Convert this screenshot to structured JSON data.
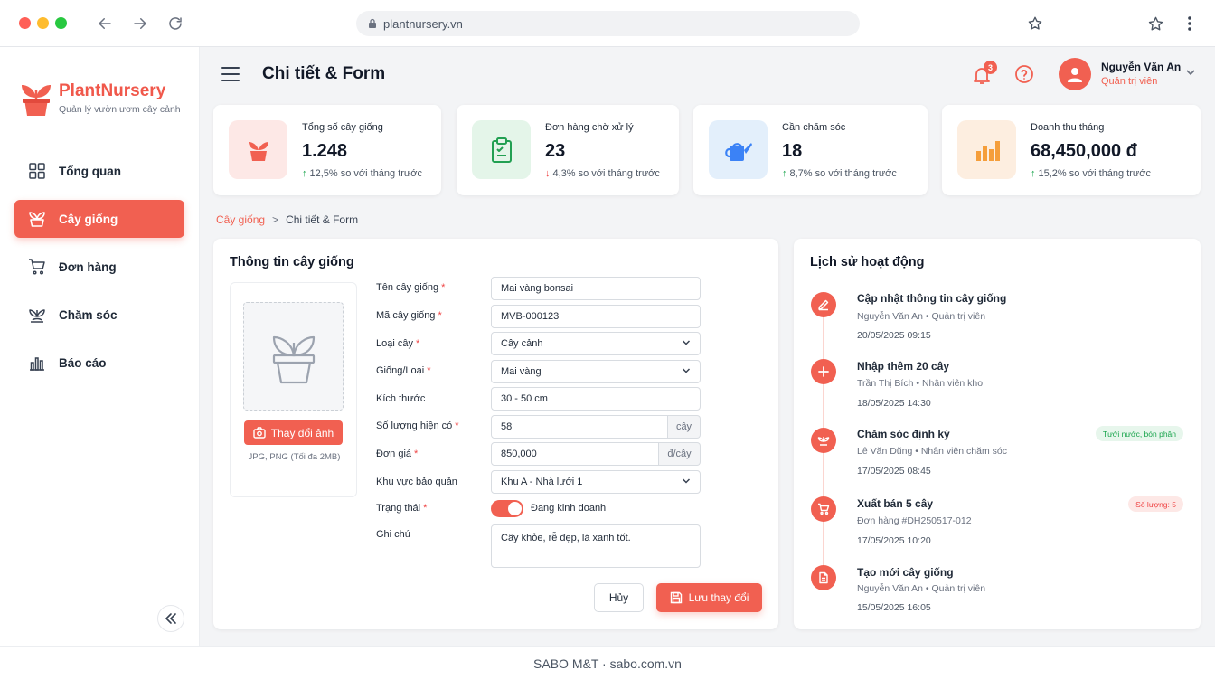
{
  "browser": {
    "url": "plantnursery.vn"
  },
  "brand": {
    "name": "PlantNursery",
    "tagline": "Quản lý vườn ươm cây cảnh",
    "accent": "#f16051"
  },
  "sidebar": {
    "items": [
      {
        "label": "Tổng quan",
        "icon": "grid-icon",
        "active": false
      },
      {
        "label": "Cây giống",
        "icon": "plant-icon",
        "active": true
      },
      {
        "label": "Đơn hàng",
        "icon": "cart-icon",
        "active": false
      },
      {
        "label": "Chăm sóc",
        "icon": "leaf-care-icon",
        "active": false
      },
      {
        "label": "Báo cáo",
        "icon": "bar-chart-icon",
        "active": false
      }
    ]
  },
  "header": {
    "title": "Chi tiết & Form",
    "notification_count": "3",
    "user": {
      "name": "Nguyễn Văn An",
      "role": "Quản trị viên"
    }
  },
  "stats": [
    {
      "label": "Tổng số cây giống",
      "value": "1.248",
      "trend": "12,5% so với tháng trước",
      "direction": "up",
      "icon": "plant-pot-icon"
    },
    {
      "label": "Đơn hàng chờ xử lý",
      "value": "23",
      "trend": "4,3% so với tháng trước",
      "direction": "down",
      "icon": "clipboard-icon"
    },
    {
      "label": "Cần chăm sóc",
      "value": "18",
      "trend": "8,7% so với tháng trước",
      "direction": "up",
      "icon": "watering-can-icon"
    },
    {
      "label": "Doanh thu tháng",
      "value": "68,450,000 đ",
      "trend": "15,2% so với tháng trước",
      "direction": "up",
      "icon": "bar-chart-icon"
    }
  ],
  "breadcrumb": {
    "parent": "Cây giống",
    "current": "Chi tiết & Form"
  },
  "form": {
    "title": "Thông tin cây giống",
    "upload_label": "Thay đổi ảnh",
    "upload_note": "JPG, PNG (Tối đa 2MB)",
    "fields": [
      {
        "label": "Tên cây giống",
        "required": true,
        "value": "Mai vàng bonsai",
        "kind": "text"
      },
      {
        "label": "Mã cây giống",
        "required": true,
        "value": "MVB-000123",
        "kind": "text"
      },
      {
        "label": "Loại cây",
        "required": true,
        "value": "Cây cảnh",
        "kind": "select"
      },
      {
        "label": "Giống/Loại",
        "required": true,
        "value": "Mai vàng",
        "kind": "select"
      },
      {
        "label": "Kích thước",
        "required": false,
        "value": "30 - 50 cm",
        "kind": "text"
      },
      {
        "label": "Số lượng hiện có",
        "required": true,
        "value": "58",
        "kind": "suffix",
        "suffix": "cây"
      },
      {
        "label": "Đơn giá",
        "required": true,
        "value": "850,000",
        "kind": "suffix",
        "suffix": "đ/cây"
      },
      {
        "label": "Khu vực bảo quản",
        "required": false,
        "value": "Khu A - Nhà lưới 1",
        "kind": "select"
      }
    ],
    "status_label": "Trạng thái",
    "status_value": "Đang kinh doanh",
    "note_label": "Ghi chú",
    "note_value": "Cây khỏe, rễ đẹp, lá xanh tốt.",
    "cancel_label": "Hủy",
    "save_label": "Lưu thay đổi"
  },
  "history": {
    "title": "Lịch sử hoạt động",
    "items": [
      {
        "title": "Cập nhật thông tin cây giống",
        "actor": "Nguyễn Văn An",
        "role": "Quản trị viên",
        "time": "20/05/2025 09:15",
        "icon": "edit-icon",
        "tag": ""
      },
      {
        "title": "Nhập thêm 20 cây",
        "actor": "Trần Thị Bích",
        "role": "Nhân viên kho",
        "time": "18/05/2025 14:30",
        "icon": "plus-icon",
        "tag": ""
      },
      {
        "title": "Chăm sóc định kỳ",
        "actor": "Lê Văn Dũng",
        "role": "Nhân viên chăm sóc",
        "time": "17/05/2025 08:45",
        "icon": "leaf-care-icon",
        "tag": "Tưới nước, bón phân",
        "tag_color": "#16a34a",
        "tag_bg": "#e7f6ec"
      },
      {
        "title": "Xuất bán 5 cây",
        "actor": "Đơn hàng #DH250517-012",
        "role": "",
        "time": "17/05/2025 10:20",
        "icon": "cart-icon",
        "tag": "Số lượng: 5",
        "tag_color": "#ef4444",
        "tag_bg": "#fde8e6"
      },
      {
        "title": "Tạo mới cây giống",
        "actor": "Nguyễn Văn An",
        "role": "Quản trị viên",
        "time": "15/05/2025 16:05",
        "icon": "document-icon",
        "tag": ""
      }
    ]
  },
  "footer": {
    "text": "SABO M&T · sabo.com.vn"
  }
}
